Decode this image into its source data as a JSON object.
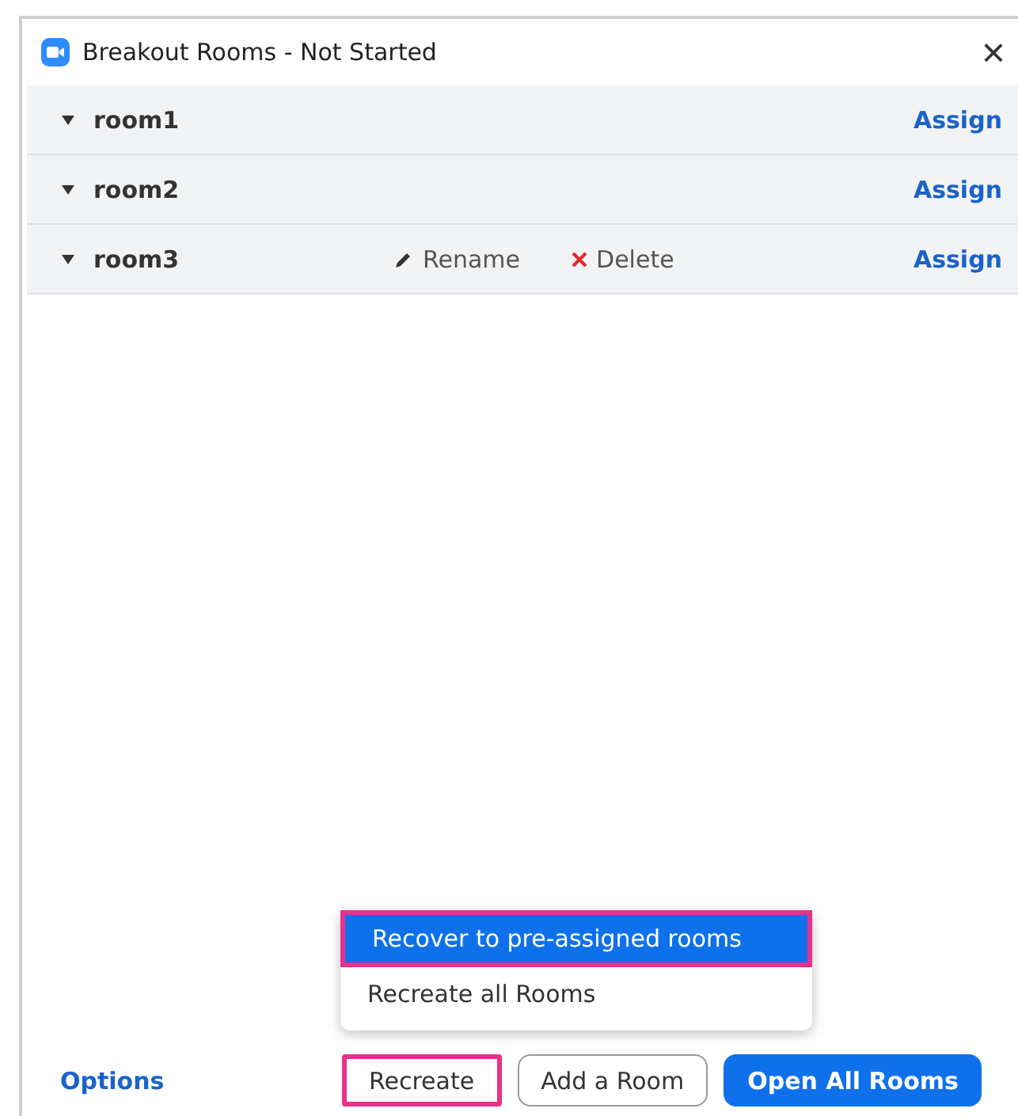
{
  "window": {
    "title": "Breakout Rooms - Not Started",
    "close": "×"
  },
  "rooms": [
    {
      "name": "room1",
      "expanded": true,
      "assign": "Assign"
    },
    {
      "name": "room2",
      "expanded": true,
      "assign": "Assign"
    },
    {
      "name": "room3",
      "expanded": true,
      "actions": [
        {
          "kind": "rename",
          "label": "Rename"
        },
        {
          "kind": "delete",
          "label": "Delete"
        }
      ],
      "assign": "Assign"
    }
  ],
  "menu": [
    {
      "label": "Recover to pre-assigned rooms",
      "selected": true,
      "highlighted": true
    },
    {
      "label": "Recreate all Rooms",
      "selected": false,
      "highlighted": false
    }
  ],
  "footer": {
    "options": "Options",
    "buttons": [
      {
        "label": "Recreate",
        "kind": "outline",
        "highlighted": true
      },
      {
        "label": "Add a Room",
        "kind": "outline",
        "highlighted": false
      },
      {
        "label": "Open All Rooms",
        "kind": "primary",
        "highlighted": false
      }
    ]
  }
}
